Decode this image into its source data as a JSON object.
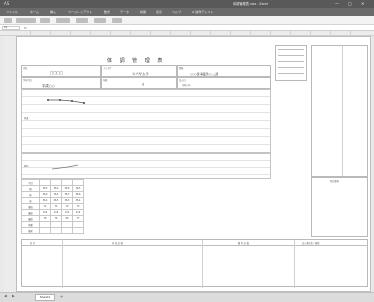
{
  "titlebar": {
    "autosave": "AS",
    "title": "体調管理表.xlsx - Excel",
    "minimize": "—",
    "maximize": "□",
    "close": "✕"
  },
  "menubar": {
    "tabs": [
      "ファイル",
      "ホーム",
      "挿入",
      "ページレイアウト",
      "数式",
      "データ",
      "校閲",
      "表示",
      "ヘルプ",
      "Q 操作アシスト"
    ]
  },
  "formulabar": {
    "namebox": "A1",
    "fx": "fx"
  },
  "sheet": {
    "title": "体 調 管 理 表",
    "fields": [
      {
        "label": "氏名",
        "value": "□□□□"
      },
      {
        "label": "フリガナ",
        "value": "ツバサムラ"
      },
      {
        "label": "所属",
        "value": "○○○課 事業部○○ △課"
      },
      {
        "label": "生年月日",
        "value": "平成○○"
      },
      {
        "label": "年齢",
        "value": "歳"
      },
      {
        "label": "記入日",
        "value": "令和○年"
      }
    ],
    "side_labels": [
      "体温",
      "脈拍",
      "血圧"
    ],
    "notes_header": "特記事項",
    "footer_headers": [
      "区 分",
      "内 容 記 載",
      "備 考 記 載",
      "記入者氏名 / 確認"
    ],
    "table_rows": [
      {
        "label": "月日",
        "cells": [
          "",
          "",
          "",
          ""
        ]
      },
      {
        "label": "朝",
        "cells": [
          "36.5",
          "36.4",
          "36.6",
          "36.5"
        ]
      },
      {
        "label": "昼",
        "cells": [
          "36.6",
          "36.5",
          "36.7",
          "36.6"
        ]
      },
      {
        "label": "夜",
        "cells": [
          "36.4",
          "36.5",
          "36.5",
          "36.4"
        ]
      },
      {
        "label": "脈拍",
        "cells": [
          "72",
          "74",
          "70",
          "73"
        ]
      },
      {
        "label": "最高",
        "cells": [
          "120",
          "118",
          "122",
          "119"
        ]
      },
      {
        "label": "最低",
        "cells": [
          "78",
          "76",
          "80",
          "77"
        ]
      },
      {
        "label": "体重",
        "cells": [
          "",
          "",
          "",
          ""
        ]
      },
      {
        "label": "備考",
        "cells": [
          "",
          "",
          "",
          ""
        ]
      }
    ]
  },
  "sheettab": "Sheet1",
  "addsheet": "+"
}
